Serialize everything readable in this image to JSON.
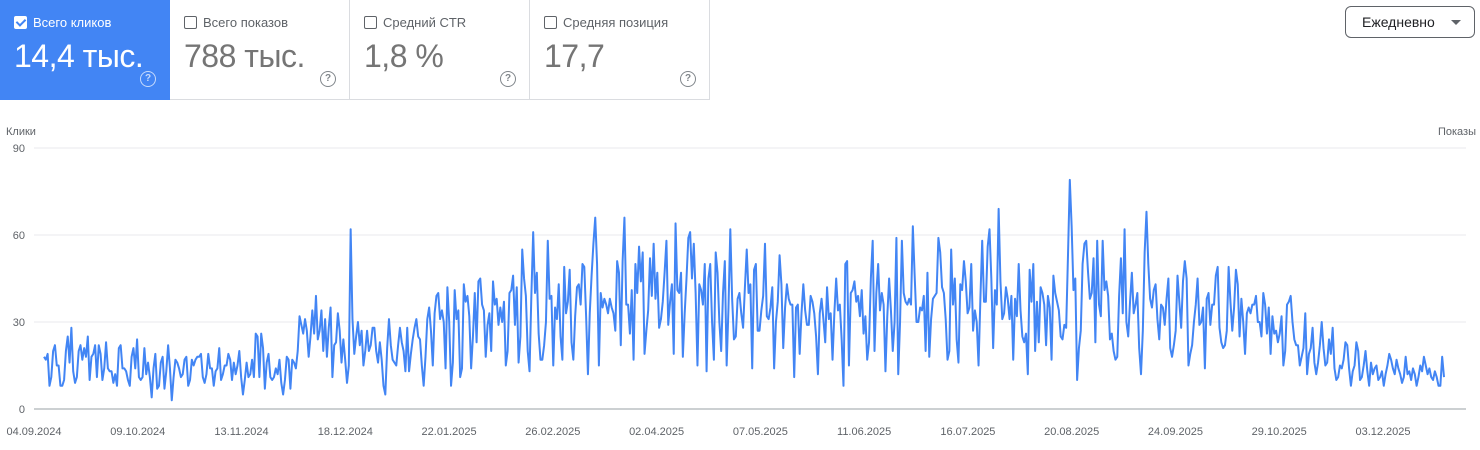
{
  "metrics": [
    {
      "label": "Всего кликов",
      "value": "14,4 тыс.",
      "checked": true
    },
    {
      "label": "Всего показов",
      "value": "788 тыс.",
      "checked": false
    },
    {
      "label": "Средний CTR",
      "value": "1,8 %",
      "checked": false
    },
    {
      "label": "Средняя позиция",
      "value": "17,7",
      "checked": false
    }
  ],
  "help_glyph": "?",
  "period_select": {
    "value": "Ежедневно"
  },
  "colors": {
    "accent": "#4285f4",
    "line": "#4285f4",
    "grid": "#e8eaed"
  },
  "chart_data": {
    "type": "line",
    "ylabel_left": "Клики",
    "ylabel_right": "Показы",
    "ylim": [
      0,
      90
    ],
    "yticks": [
      "0",
      "30",
      "60",
      "90"
    ],
    "grid": true,
    "x_start": "04.09.2024",
    "x_end": "31.12.2025",
    "xticks": [
      "04.09.2024",
      "09.10.2024",
      "13.11.2024",
      "18.12.2024",
      "22.01.2025",
      "26.02.2025",
      "02.04.2025",
      "07.05.2025",
      "11.06.2025",
      "16.07.2025",
      "20.08.2025",
      "24.09.2025",
      "29.10.2025",
      "03.12.2025"
    ],
    "series": [
      {
        "name": "Клики",
        "values": [
          18,
          17,
          19,
          8,
          11,
          20,
          22,
          15,
          15,
          8,
          8,
          10,
          20,
          25,
          16,
          28,
          13,
          9,
          11,
          20,
          22,
          17,
          21,
          18,
          25,
          10,
          18,
          19,
          22,
          11,
          22,
          19,
          10,
          14,
          23,
          14,
          13,
          13,
          9,
          12,
          8,
          21,
          22,
          14,
          14,
          13,
          10,
          8,
          18,
          21,
          14,
          24,
          11,
          10,
          11,
          21,
          12,
          16,
          11,
          4,
          14,
          19,
          7,
          8,
          16,
          18,
          7,
          13,
          22,
          14,
          3,
          11,
          17,
          16,
          14,
          11,
          12,
          17,
          18,
          8,
          10,
          17,
          15,
          17,
          18,
          18,
          19,
          11,
          9,
          12,
          19,
          14,
          14,
          8,
          13,
          14,
          21,
          10,
          12,
          15,
          15,
          19,
          17,
          10,
          16,
          12,
          15,
          20,
          11,
          5,
          10,
          16,
          11,
          12,
          17,
          11,
          26,
          25,
          11,
          26,
          21,
          7,
          16,
          19,
          11,
          10,
          11,
          14,
          12,
          17,
          9,
          5,
          10,
          18,
          17,
          7,
          17,
          16,
          14,
          20,
          32,
          29,
          26,
          31,
          27,
          18,
          25,
          34,
          26,
          39,
          24,
          27,
          34,
          20,
          31,
          18,
          28,
          35,
          11,
          22,
          23,
          33,
          27,
          16,
          24,
          17,
          9,
          15,
          62,
          31,
          19,
          25,
          30,
          22,
          27,
          15,
          20,
          27,
          20,
          22,
          28,
          28,
          20,
          16,
          23,
          17,
          8,
          5,
          21,
          31,
          22,
          17,
          16,
          15,
          22,
          28,
          23,
          20,
          13,
          28,
          13,
          19,
          24,
          28,
          31,
          25,
          24,
          15,
          8,
          18,
          31,
          35,
          27,
          15,
          33,
          39,
          40,
          31,
          34,
          30,
          14,
          42,
          30,
          8,
          16,
          41,
          31,
          34,
          11,
          14,
          43,
          37,
          39,
          32,
          14,
          25,
          40,
          23,
          44,
          45,
          36,
          34,
          18,
          29,
          33,
          20,
          44,
          36,
          38,
          29,
          35,
          30,
          37,
          15,
          20,
          40,
          41,
          46,
          29,
          42,
          16,
          25,
          55,
          45,
          39,
          20,
          13,
          39,
          61,
          40,
          47,
          26,
          17,
          17,
          22,
          30,
          58,
          38,
          39,
          15,
          35,
          31,
          43,
          25,
          17,
          49,
          33,
          37,
          48,
          23,
          17,
          32,
          42,
          43,
          36,
          50,
          49,
          32,
          12,
          33,
          46,
          57,
          66,
          50,
          15,
          40,
          35,
          38,
          36,
          33,
          38,
          35,
          33,
          27,
          51,
          47,
          22,
          51,
          66,
          36,
          36,
          26,
          41,
          17,
          50,
          40,
          56,
          44,
          54,
          19,
          27,
          34,
          52,
          39,
          57,
          38,
          47,
          28,
          31,
          37,
          47,
          58,
          29,
          37,
          43,
          19,
          64,
          41,
          40,
          47,
          18,
          33,
          45,
          59,
          61,
          45,
          57,
          40,
          15,
          43,
          41,
          36,
          50,
          13,
          45,
          50,
          30,
          17,
          54,
          47,
          30,
          20,
          40,
          51,
          15,
          35,
          62,
          38,
          24,
          25,
          38,
          40,
          33,
          28,
          42,
          55,
          40,
          43,
          14,
          48,
          50,
          27,
          27,
          34,
          39,
          57,
          32,
          31,
          35,
          42,
          14,
          30,
          37,
          53,
          43,
          21,
          35,
          43,
          38,
          36,
          36,
          11,
          35,
          36,
          19,
          33,
          43,
          34,
          29,
          29,
          39,
          37,
          33,
          25,
          12,
          33,
          38,
          31,
          23,
          42,
          31,
          33,
          17,
          33,
          45,
          34,
          36,
          24,
          8,
          50,
          51,
          15,
          40,
          41,
          44,
          37,
          39,
          32,
          41,
          26,
          32,
          17,
          23,
          45,
          58,
          20,
          40,
          50,
          34,
          40,
          36,
          13,
          32,
          45,
          34,
          20,
          30,
          59,
          12,
          30,
          58,
          40,
          37,
          36,
          38,
          36,
          63,
          46,
          30,
          30,
          35,
          34,
          39,
          20,
          47,
          18,
          31,
          38,
          39,
          40,
          59,
          54,
          42,
          40,
          31,
          17,
          20,
          55,
          36,
          45,
          24,
          16,
          43,
          41,
          51,
          44,
          33,
          35,
          50,
          27,
          34,
          30,
          15,
          38,
          58,
          37,
          37,
          56,
          62,
          45,
          21,
          41,
          36,
          69,
          44,
          31,
          33,
          42,
          38,
          31,
          39,
          17,
          38,
          32,
          50,
          34,
          25,
          23,
          26,
          12,
          48,
          37,
          50,
          20,
          37,
          23,
          42,
          40,
          36,
          22,
          39,
          35,
          17,
          46,
          40,
          37,
          34,
          25,
          24,
          29,
          28,
          53,
          79,
          63,
          41,
          45,
          10,
          21,
          27,
          50,
          57,
          58,
          47,
          38,
          40,
          52,
          23,
          58,
          36,
          32,
          58,
          41,
          44,
          39,
          24,
          26,
          20,
          17,
          18,
          39,
          52,
          33,
          62,
          30,
          25,
          37,
          47,
          33,
          36,
          40,
          21,
          12,
          27,
          54,
          68,
          50,
          38,
          35,
          41,
          43,
          31,
          24,
          36,
          35,
          29,
          38,
          45,
          21,
          18,
          22,
          27,
          46,
          37,
          28,
          44,
          51,
          45,
          15,
          19,
          22,
          30,
          36,
          45,
          29,
          30,
          35,
          14,
          38,
          40,
          29,
          36,
          36,
          46,
          49,
          28,
          23,
          21,
          22,
          27,
          49,
          37,
          27,
          35,
          48,
          43,
          25,
          38,
          30,
          19,
          33,
          35,
          33,
          36,
          36,
          39,
          30,
          30,
          25,
          40,
          36,
          26,
          35,
          19,
          32,
          26,
          27,
          23,
          26,
          32,
          15,
          20,
          36,
          37,
          39,
          30,
          24,
          22,
          22,
          15,
          18,
          21,
          33,
          12,
          19,
          21,
          28,
          16,
          12,
          16,
          22,
          30,
          21,
          15,
          16,
          24,
          19,
          28,
          14,
          10,
          11,
          15,
          14,
          17,
          23,
          22,
          14,
          8,
          13,
          15,
          23,
          20,
          10,
          11,
          15,
          20,
          13,
          8,
          16,
          12,
          14,
          15,
          10,
          11,
          13,
          8,
          12,
          15,
          19,
          17,
          14,
          12,
          17,
          14,
          12,
          9,
          11,
          18,
          12,
          13,
          10,
          14,
          12,
          8,
          11,
          15,
          13,
          18,
          15,
          12,
          14,
          11,
          10,
          13,
          11,
          8,
          8,
          18,
          11
        ]
      }
    ]
  }
}
